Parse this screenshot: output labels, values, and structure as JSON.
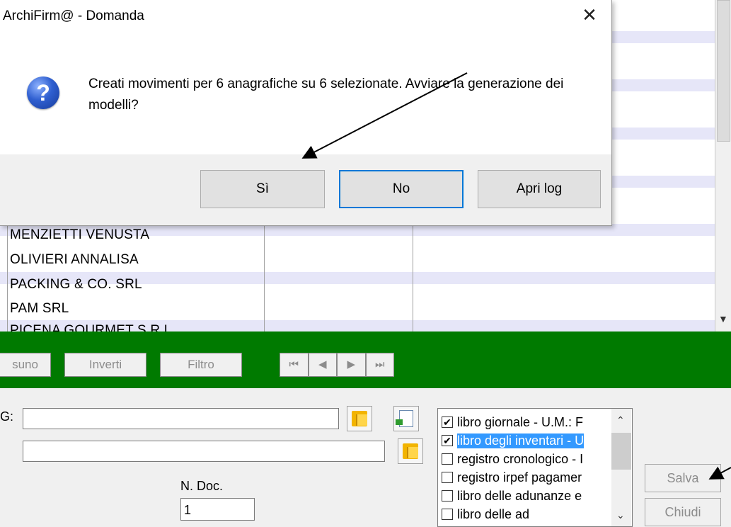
{
  "dialog": {
    "title": "ArchiFirm@ - Domanda",
    "message": "Creati movimenti per 6 anagrafiche su 6 selezionate. Avviare la generazione dei modelli?",
    "icon": "question-icon",
    "buttons": {
      "yes": "Sì",
      "no": "No",
      "log": "Apri log"
    },
    "close_icon": "close-icon"
  },
  "grid": {
    "rows": [
      "MENZIETTI VENUSTA",
      "OLIVIERI ANNALISA",
      "PACKING & CO. SRL",
      "PAM SRL",
      "PICENA GOURMET S.R.L."
    ]
  },
  "toolbar": {
    "nessuno": "suno",
    "inverti": "Inverti",
    "filtro": "Filtro",
    "nav": {
      "first": "⏮",
      "prev": "◀",
      "next": "▶",
      "last": "⏭"
    }
  },
  "form": {
    "field1_label": "G:",
    "field1_value": "",
    "field2_value": "",
    "ndoc_label": "N. Doc.",
    "ndoc_value": "1"
  },
  "checklist": [
    {
      "label": "libro giornale - U.M.: F",
      "checked": true,
      "selected": false
    },
    {
      "label": "libro degli inventari - U",
      "checked": true,
      "selected": true
    },
    {
      "label": "registro cronologico - I",
      "checked": false,
      "selected": false
    },
    {
      "label": "registro irpef pagamer",
      "checked": false,
      "selected": false
    },
    {
      "label": "libro delle adunanze e",
      "checked": false,
      "selected": false
    },
    {
      "label": "libro delle ad",
      "checked": false,
      "selected": false
    }
  ],
  "side_buttons": {
    "salva": "Salva",
    "chiudi": "Chiudi"
  },
  "colors": {
    "toolbar": "#007a00",
    "stripe": "#e6e6f8",
    "selection": "#3399ff",
    "dialog_default": "#0078d7"
  }
}
